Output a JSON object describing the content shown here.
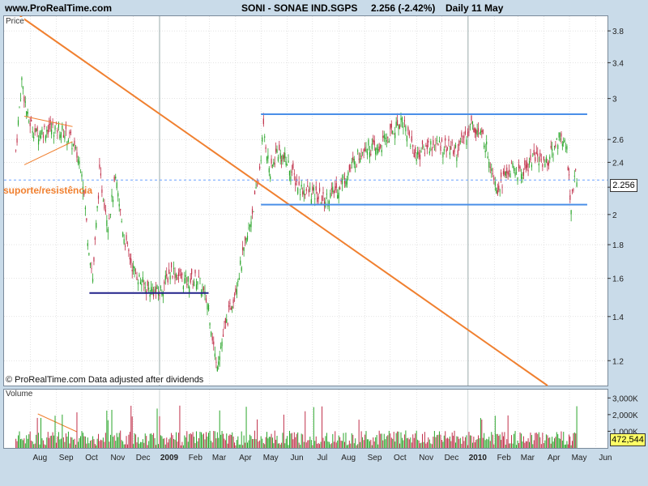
{
  "header": {
    "site": "www.ProRealTime.com",
    "instrument": "SONI - SONAE IND.SGPS",
    "price_change": "2.256 (-2.42%)",
    "period": "Daily  11 May"
  },
  "price_panel_label": "Price",
  "volume_panel_label": "Volume",
  "footer_note": "© ProRealTime.com  Data adjusted after dividends",
  "annotation": "suporte/resistência",
  "current_price_tag": "2.256",
  "current_volume_tag": "472,544",
  "colors": {
    "up": "#2aa52a",
    "down": "#c0304a",
    "trend_orange": "#f08030",
    "channel_blue": "#4a8fe8",
    "support_navy": "#22228a",
    "grid": "#c8c8c8"
  },
  "chart_data": [
    {
      "type": "candlestick",
      "title": "SONI - SONAE IND.SGPS",
      "y_scale": "log",
      "ylim": [
        1.1,
        4.0
      ],
      "y_ticks": [
        "1.2",
        "1.4",
        "1.6",
        "1.8",
        "2",
        "2.2",
        "2.4",
        "2.6",
        "3",
        "3.4",
        "3.8"
      ],
      "x_ticks": [
        "Aug",
        "Sep",
        "Oct",
        "Nov",
        "Dec",
        "2009",
        "Feb",
        "Mar",
        "Apr",
        "May",
        "Jun",
        "Jul",
        "Aug",
        "Sep",
        "Oct",
        "Nov",
        "Dec",
        "2010",
        "Feb",
        "Mar",
        "Apr",
        "May",
        "Jun"
      ],
      "series": [
        {
          "values": [
            {
              "date": "2008-07-15",
              "close": 2.5
            },
            {
              "date": "2008-07-22",
              "close": 3.2
            },
            {
              "date": "2008-07-29",
              "close": 2.8
            },
            {
              "date": "2008-08-08",
              "close": 2.65
            },
            {
              "date": "2008-08-22",
              "close": 2.7
            },
            {
              "date": "2008-09-05",
              "close": 2.7
            },
            {
              "date": "2008-09-18",
              "close": 2.6
            },
            {
              "date": "2008-10-01",
              "close": 2.35
            },
            {
              "date": "2008-10-08",
              "close": 1.85
            },
            {
              "date": "2008-10-14",
              "close": 1.6
            },
            {
              "date": "2008-10-22",
              "close": 2.3
            },
            {
              "date": "2008-11-01",
              "close": 1.95
            },
            {
              "date": "2008-11-10",
              "close": 2.25
            },
            {
              "date": "2008-11-20",
              "close": 1.85
            },
            {
              "date": "2008-12-01",
              "close": 1.65
            },
            {
              "date": "2008-12-15",
              "close": 1.55
            },
            {
              "date": "2009-01-01",
              "close": 1.52
            },
            {
              "date": "2009-01-15",
              "close": 1.65
            },
            {
              "date": "2009-02-01",
              "close": 1.58
            },
            {
              "date": "2009-02-15",
              "close": 1.6
            },
            {
              "date": "2009-02-28",
              "close": 1.45
            },
            {
              "date": "2009-03-09",
              "close": 1.18
            },
            {
              "date": "2009-03-20",
              "close": 1.35
            },
            {
              "date": "2009-04-01",
              "close": 1.55
            },
            {
              "date": "2009-04-15",
              "close": 1.85
            },
            {
              "date": "2009-04-28",
              "close": 2.25
            },
            {
              "date": "2009-05-04",
              "close": 2.7
            },
            {
              "date": "2009-05-12",
              "close": 2.3
            },
            {
              "date": "2009-05-20",
              "close": 2.5
            },
            {
              "date": "2009-06-01",
              "close": 2.4
            },
            {
              "date": "2009-06-15",
              "close": 2.2
            },
            {
              "date": "2009-07-01",
              "close": 2.15
            },
            {
              "date": "2009-07-15",
              "close": 2.1
            },
            {
              "date": "2009-08-01",
              "close": 2.2
            },
            {
              "date": "2009-08-15",
              "close": 2.35
            },
            {
              "date": "2009-09-01",
              "close": 2.55
            },
            {
              "date": "2009-09-15",
              "close": 2.5
            },
            {
              "date": "2009-10-01",
              "close": 2.65
            },
            {
              "date": "2009-10-15",
              "close": 2.8
            },
            {
              "date": "2009-11-01",
              "close": 2.45
            },
            {
              "date": "2009-11-15",
              "close": 2.55
            },
            {
              "date": "2009-12-01",
              "close": 2.55
            },
            {
              "date": "2009-12-20",
              "close": 2.5
            },
            {
              "date": "2010-01-05",
              "close": 2.75
            },
            {
              "date": "2010-01-20",
              "close": 2.6
            },
            {
              "date": "2010-02-05",
              "close": 2.2
            },
            {
              "date": "2010-02-20",
              "close": 2.35
            },
            {
              "date": "2010-03-05",
              "close": 2.3
            },
            {
              "date": "2010-03-20",
              "close": 2.45
            },
            {
              "date": "2010-04-05",
              "close": 2.4
            },
            {
              "date": "2010-04-20",
              "close": 2.65
            },
            {
              "date": "2010-04-28",
              "close": 2.5
            },
            {
              "date": "2010-05-03",
              "close": 2.05
            },
            {
              "date": "2010-05-07",
              "close": 2.3
            },
            {
              "date": "2010-05-11",
              "close": 2.256
            }
          ]
        }
      ],
      "annotations": {
        "down_trendline": [
          {
            "date": "2008-07-20",
            "price": 4.0
          },
          {
            "date": "2010-04-05",
            "price": 1.1
          }
        ],
        "channel_top": [
          {
            "date": "2009-05-01",
            "price": 2.84
          },
          {
            "date": "2010-05-22",
            "price": 2.84
          }
        ],
        "channel_bottom": [
          {
            "date": "2009-05-01",
            "price": 2.07
          },
          {
            "date": "2010-05-22",
            "price": 2.07
          }
        ],
        "support_line": [
          {
            "date": "2008-10-10",
            "price": 1.52
          },
          {
            "date": "2009-02-28",
            "price": 1.52
          }
        ],
        "reference_level": 2.256
      }
    },
    {
      "type": "bar",
      "title": "Volume",
      "y_ticks": [
        "1,000K",
        "2,000K",
        "3,000K"
      ],
      "ylim": [
        0,
        3500000
      ],
      "last_value": 472544
    }
  ]
}
